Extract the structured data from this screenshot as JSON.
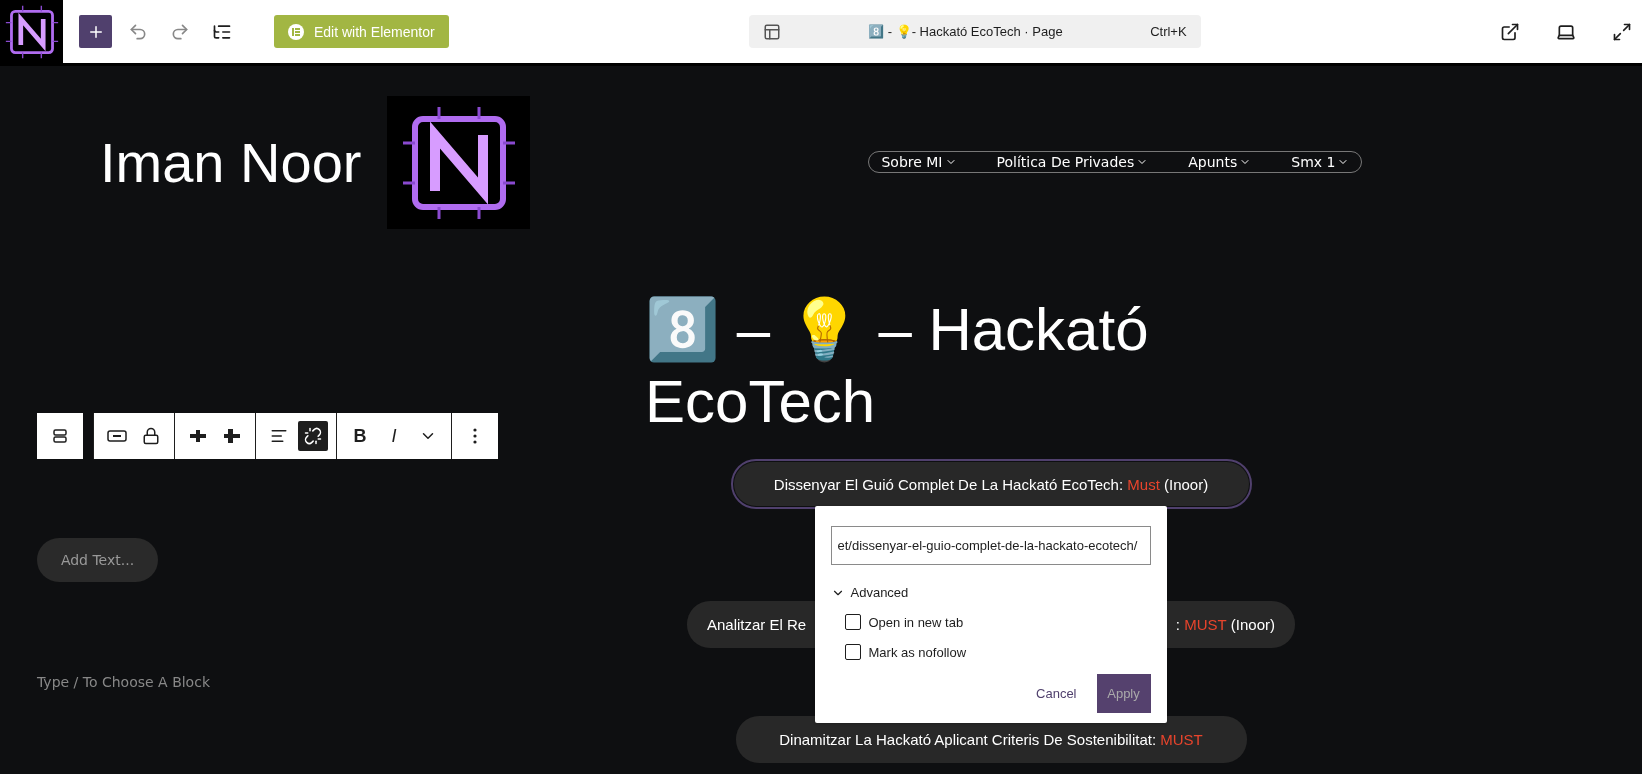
{
  "top_bar": {
    "edit_button": "Edit with Elementor",
    "command": {
      "title": "8️⃣ - 💡- Hackató EcoTech · Page",
      "shortcut": "Ctrl+K"
    }
  },
  "site": {
    "name": "Iman Noor",
    "nav": [
      {
        "label": "Sobre MI"
      },
      {
        "label": "Política De Privades"
      },
      {
        "label": "Apunts"
      },
      {
        "label": "Smx 1"
      }
    ]
  },
  "block_toolbar": [
    [
      {
        "kind": "block-type",
        "pressed": false
      }
    ],
    [
      {
        "kind": "width",
        "pressed": false
      },
      {
        "kind": "lock",
        "pressed": false
      }
    ],
    [
      {
        "kind": "move-left",
        "pressed": false
      },
      {
        "kind": "move-right",
        "pressed": false
      }
    ],
    [
      {
        "kind": "align",
        "pressed": false
      },
      {
        "kind": "unlink",
        "pressed": true
      }
    ],
    [
      {
        "kind": "text",
        "label": "B",
        "pressed": false
      },
      {
        "kind": "italic",
        "label": "I",
        "pressed": false
      },
      {
        "kind": "more-formats",
        "pressed": false
      }
    ],
    [
      {
        "kind": "options",
        "pressed": false
      }
    ]
  ],
  "add_text": "Add Text...",
  "block_hint": "Type / To Choose A Block",
  "heading": "8️⃣ – 💡 – Hackató EcoTech",
  "items": [
    {
      "kind": "full",
      "parts": [
        {
          "text": "Dissenyar El Guió Complet De La Hackató EcoTech: "
        },
        {
          "text": "Must",
          "highlight": true
        },
        {
          "text": " (Inoor)"
        }
      ],
      "selected": true
    },
    {
      "kind": "covered",
      "start": [
        {
          "text": "Analitzar El Re"
        }
      ],
      "end": [
        {
          "text": ": "
        },
        {
          "text": "MUST",
          "highlight": true
        },
        {
          "text": " (Inoor)"
        }
      ],
      "selected": false
    },
    {
      "kind": "full",
      "parts": [
        {
          "text": "Dinamitzar La Hackató Aplicant Criteris De Sostenibilitat: "
        },
        {
          "text": "MUST",
          "highlight": true
        }
      ],
      "selected": false
    }
  ],
  "link_popover": {
    "url": "et/dissenyar-el-guio-complet-de-la-hackato-ecotech/",
    "advanced": {
      "label": "Advanced",
      "expanded": true
    },
    "options": [
      {
        "label": "Open in new tab",
        "checked": false
      },
      {
        "label": "Mark as nofollow",
        "checked": false
      }
    ],
    "cancel": "Cancel",
    "apply": "Apply"
  }
}
